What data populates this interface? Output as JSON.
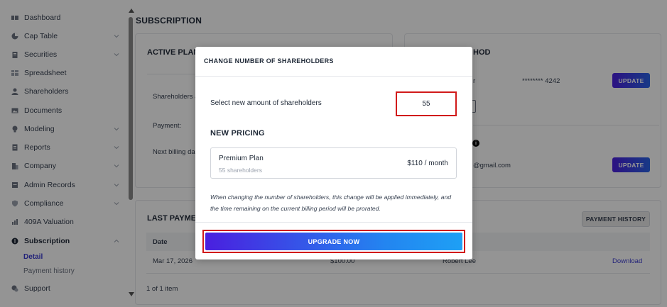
{
  "sidebar": {
    "items": [
      {
        "label": "Dashboard",
        "icon": "dashboard-icon",
        "chevron": false
      },
      {
        "label": "Cap Table",
        "icon": "pie-chart-icon",
        "chevron": true
      },
      {
        "label": "Securities",
        "icon": "clipboard-icon",
        "chevron": true
      },
      {
        "label": "Spreadsheet",
        "icon": "grid-icon",
        "chevron": false
      },
      {
        "label": "Shareholders",
        "icon": "person-icon",
        "chevron": false
      },
      {
        "label": "Documents",
        "icon": "image-icon",
        "chevron": false
      },
      {
        "label": "Modeling",
        "icon": "lightbulb-icon",
        "chevron": true
      },
      {
        "label": "Reports",
        "icon": "report-icon",
        "chevron": true
      },
      {
        "label": "Company",
        "icon": "building-icon",
        "chevron": true
      },
      {
        "label": "Admin Records",
        "icon": "records-icon",
        "chevron": true
      },
      {
        "label": "Compliance",
        "icon": "shield-icon",
        "chevron": true
      },
      {
        "label": "409A Valuation",
        "icon": "chart-icon",
        "chevron": false
      },
      {
        "label": "Subscription",
        "icon": "dollar-icon",
        "chevron": true
      },
      {
        "label": "Support",
        "icon": "support-icon",
        "chevron": false
      }
    ],
    "subitems": [
      {
        "label": "Detail"
      },
      {
        "label": "Payment history"
      }
    ]
  },
  "page": {
    "title": "SUBSCRIPTION"
  },
  "active_plan": {
    "title": "ACTIVE PLAN",
    "rows": [
      "Shareholders a",
      "Payment:",
      "Next billing da"
    ]
  },
  "payment_method": {
    "title": "HOD",
    "card_label": "r",
    "card_number": "******** 4242",
    "update1": "UPDATE",
    "email": "@gmail.com",
    "update2": "UPDATE"
  },
  "last_payments": {
    "title": "LAST PAYMEN",
    "history_button": "PAYMENT HISTORY",
    "columns": [
      "Date"
    ],
    "rows": [
      {
        "date": "Mar 17, 2026",
        "amount": "$100.00",
        "name": "Robert Lee",
        "action": "Download"
      }
    ],
    "count": "1 of 1 item"
  },
  "modal": {
    "title": "CHANGE NUMBER OF SHAREHOLDERS",
    "select_label": "Select new amount of shareholders",
    "shareholders_value": "55",
    "new_pricing": "NEW PRICING",
    "plan_name": "Premium Plan",
    "plan_sub": "55 shareholders",
    "plan_price": "$110 / month",
    "note": "When changing the number of shareholders, this change will be applied immediately, and the time remaining on the current billing period will be prorated.",
    "upgrade_button": "UPGRADE NOW"
  },
  "colors": {
    "accent": "#4a1fdf",
    "highlight": "#d11a1a",
    "link": "#3b3bd1"
  }
}
